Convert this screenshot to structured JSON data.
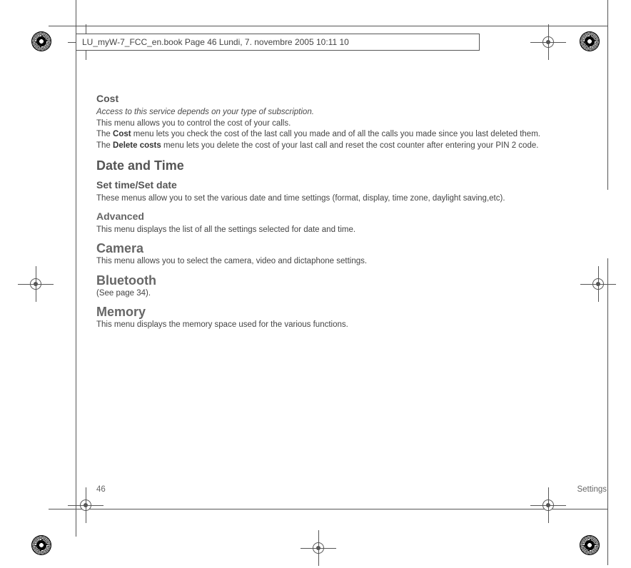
{
  "header_info": "LU_myW-7_FCC_en.book  Page 46  Lundi, 7. novembre 2005  10:11 10",
  "sections": {
    "cost": {
      "title": "Cost",
      "italic": "Access to this service depends on your type of subscription.",
      "line1": "This menu allows you to control the cost of your calls.",
      "line2_pre": "The ",
      "line2_bold": "Cost",
      "line2_post": " menu lets you check the cost of the last call you made and of all the calls you made since you last deleted them.",
      "line3_pre": "The ",
      "line3_bold": "Delete costs",
      "line3_post": " menu lets you delete the cost of your last call and reset the cost counter after entering your PIN 2 code."
    },
    "datetime": {
      "title": "Date and Time",
      "sub1_title": "Set time/Set date",
      "sub1_body": "These menus allow you to set the various date and time settings (format, display, time zone, daylight saving,etc).",
      "sub2_title": "Advanced",
      "sub2_body": "This menu displays the list of all the settings selected for date and time."
    },
    "camera": {
      "title": "Camera",
      "body": "This menu allows you to select the camera, video and dictaphone settings."
    },
    "bluetooth": {
      "title": "Bluetooth",
      "body": "(See page 34)."
    },
    "memory": {
      "title": "Memory",
      "body": "This menu displays the memory space used for the various functions."
    }
  },
  "footer": {
    "page": "46",
    "section": "Settings"
  }
}
